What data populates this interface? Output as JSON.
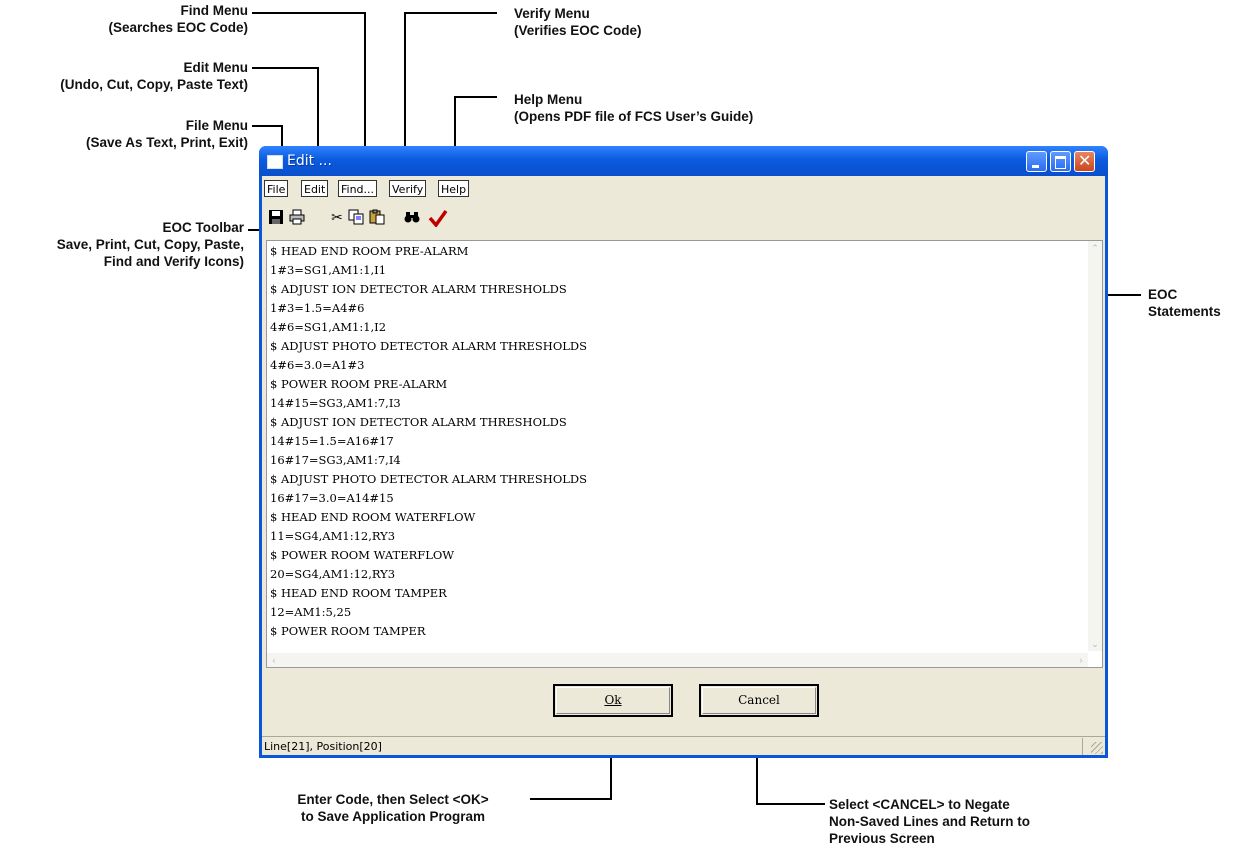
{
  "callouts": {
    "find_menu": "Find Menu\n(Searches EOC Code)",
    "edit_menu": "Edit Menu\n(Undo, Cut, Copy, Paste Text)",
    "file_menu": "File Menu\n(Save As Text, Print, Exit)",
    "eoc_toolbar": "EOC Toolbar\nSave, Print, Cut, Copy, Paste,\nFind and Verify Icons)",
    "verify_menu": "Verify Menu\n(Verifies EOC Code)",
    "help_menu": "Help Menu\n(Opens PDF file of FCS User’s Guide)",
    "eoc_statements": "EOC\nStatements",
    "ok_note": "Enter Code, then Select <OK>\nto Save Application Program",
    "cancel_note": "Select <CANCEL> to Negate\nNon-Saved Lines and Return to\nPrevious Screen"
  },
  "window": {
    "title": "Edit ...",
    "menus": [
      "File",
      "Edit",
      "Find...",
      "Verify",
      "Help"
    ],
    "toolbar_icons": [
      "save-icon",
      "print-icon",
      "cut-icon",
      "copy-icon",
      "paste-icon",
      "find-icon",
      "verify-icon"
    ],
    "verify_color": "#c00000",
    "code_lines": [
      "$ HEAD END ROOM PRE-ALARM",
      "1#3=SG1,AM1:1,I1",
      "$ ADJUST ION DETECTOR ALARM THRESHOLDS",
      "1#3=1.5=A4#6",
      "4#6=SG1,AM1:1,I2",
      "$ ADJUST PHOTO DETECTOR ALARM THRESHOLDS",
      "4#6=3.0=A1#3",
      "$ POWER ROOM PRE-ALARM",
      "14#15=SG3,AM1:7,I3",
      "$ ADJUST ION DETECTOR ALARM THRESHOLDS",
      "14#15=1.5=A16#17",
      "16#17=SG3,AM1:7,I4",
      "$ ADJUST PHOTO DETECTOR ALARM THRESHOLDS",
      "16#17=3.0=A14#15",
      "$ HEAD END ROOM WATERFLOW",
      "11=SG4,AM1:12,RY3",
      "$ POWER ROOM WATERFLOW",
      "20=SG4,AM1:12,RY3",
      "$ HEAD END ROOM TAMPER",
      "12=AM1:5,25",
      "$ POWER ROOM TAMPER"
    ],
    "ok_label": "Ok",
    "cancel_label": "Cancel",
    "status": "Line[21], Position[20]"
  }
}
